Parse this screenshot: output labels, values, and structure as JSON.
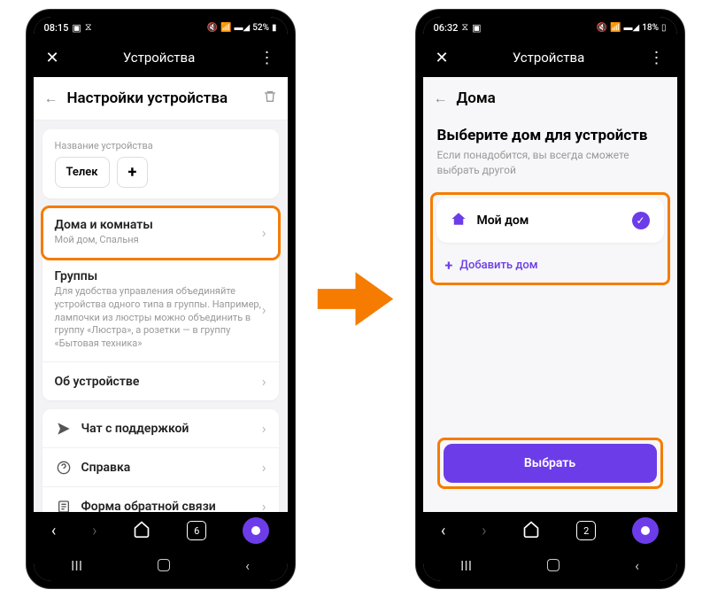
{
  "left": {
    "status": {
      "time": "08:15",
      "battery": "52%"
    },
    "appbar_title": "Устройства",
    "page_title": "Настройки устройства",
    "device_name_label": "Название устройства",
    "device_name_value": "Телек",
    "rows": {
      "homes_rooms": {
        "title": "Дома и комнаты",
        "sub": "Мой дом, Спальня"
      },
      "groups": {
        "title": "Группы",
        "sub": "Для удобства управления объединяйте устройства одного типа в группы. Например, лампочки из люстры можно объединить в группу «Люстра», а розетки — в группу «Бытовая техника»"
      },
      "about": {
        "title": "Об устройстве"
      },
      "chat": {
        "title": "Чат с поддержкой"
      },
      "help": {
        "title": "Справка"
      },
      "feedback": {
        "title": "Форма обратной связи"
      }
    },
    "tabs": "6"
  },
  "right": {
    "status": {
      "time": "06:32",
      "battery": "18%"
    },
    "appbar_title": "Устройства",
    "page_title": "Дома",
    "select_title": "Выберите дом для устройств",
    "select_sub": "Если понадобится, вы всегда сможете выбрать другой",
    "home_name": "Мой дом",
    "add_home": "Добавить дом",
    "primary": "Выбрать",
    "tabs": "2"
  }
}
